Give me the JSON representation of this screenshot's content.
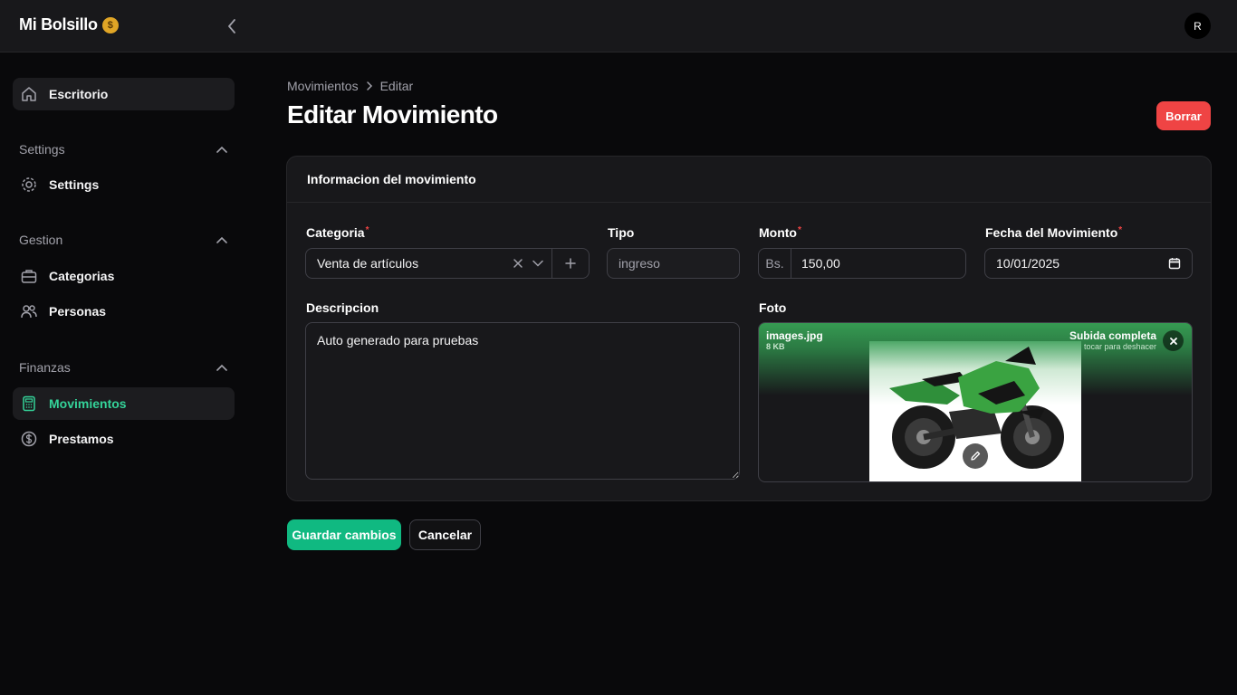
{
  "app": {
    "brand": "Mi Bolsillo",
    "brand_emoji": "$",
    "user_initial": "R"
  },
  "sidebar": {
    "dashboard": "Escritorio",
    "groups": [
      {
        "title": "Settings",
        "items": [
          "Settings"
        ]
      },
      {
        "title": "Gestion",
        "items": [
          "Categorias",
          "Personas"
        ]
      },
      {
        "title": "Finanzas",
        "items": [
          "Movimientos",
          "Prestamos"
        ]
      }
    ],
    "active_item": "Movimientos"
  },
  "breadcrumb": {
    "parent": "Movimientos",
    "current": "Editar"
  },
  "page": {
    "title": "Editar Movimiento",
    "delete_label": "Borrar"
  },
  "form": {
    "section_title": "Informacion del movimiento",
    "categoria": {
      "label": "Categoria",
      "required": "*",
      "value": "Venta de artículos"
    },
    "tipo": {
      "label": "Tipo",
      "value": "ingreso"
    },
    "monto": {
      "label": "Monto",
      "required": "*",
      "prefix": "Bs.",
      "value": "150,00"
    },
    "fecha": {
      "label": "Fecha del Movimiento",
      "required": "*",
      "value": "10/01/2025"
    },
    "descripcion": {
      "label": "Descripcion",
      "value": "Auto generado para pruebas"
    },
    "foto": {
      "label": "Foto",
      "file_name": "images.jpg",
      "file_size": "8 KB",
      "status": "Subida completa",
      "hint": "tocar para deshacer"
    }
  },
  "actions": {
    "save": "Guardar cambios",
    "cancel": "Cancelar"
  },
  "colors": {
    "primary": "#10b981",
    "danger": "#ef4444",
    "background": "#09090b",
    "surface": "#18181b"
  }
}
